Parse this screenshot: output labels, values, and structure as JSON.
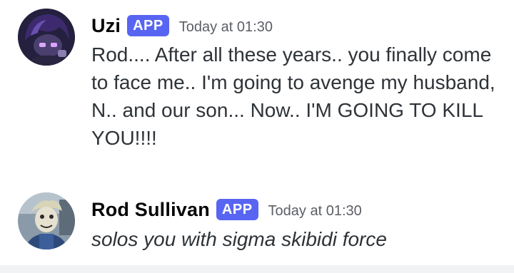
{
  "messages": [
    {
      "username": "Uzi",
      "badge": "APP",
      "timestamp": "Today at 01:30",
      "text": "Rod.... After all these years.. you finally come to face me.. I'm going to avenge my husband, N.. and our son... Now.. I'M GOING TO KILL YOU!!!!"
    },
    {
      "username": "Rod Sullivan",
      "badge": "APP",
      "timestamp": "Today at 01:30",
      "text": "solos you with sigma skibidi force"
    }
  ],
  "colors": {
    "badge": "#5865f2",
    "username": "#060607",
    "timestamp": "#5c5e66",
    "text": "#2e3338"
  }
}
